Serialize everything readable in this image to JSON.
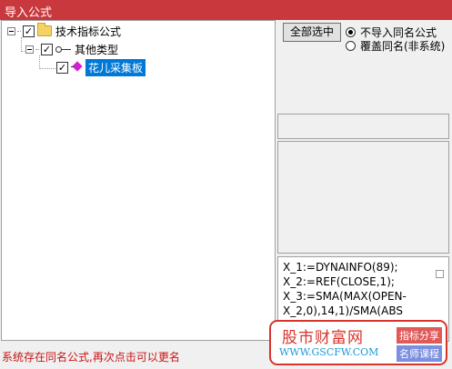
{
  "window": {
    "title": "导入公式"
  },
  "tree": {
    "root": {
      "label": "技术指标公式",
      "checked": true
    },
    "child": {
      "label": "其他类型",
      "checked": true
    },
    "leaf": {
      "label": "花儿采集板",
      "checked": true
    }
  },
  "options": {
    "select_all_label": "全部选中",
    "radio_skip_label": "不导入同名公式",
    "radio_overwrite_label": "覆盖同名(非系统)",
    "selected": "radio_skip"
  },
  "formula_code": [
    "X_1:=DYNAINFO(89);",
    "X_2:=REF(CLOSE,1);",
    "X_3:=SMA(MAX(OPEN-",
    "X_2,0),14,1)/SMA(ABS"
  ],
  "watermark": {
    "title": "股市财富网",
    "url": "WWW.GSCFW.COM",
    "tag1": "指标分享",
    "tag2": "名师课程"
  },
  "status_message": "系统存在同名公式,再次点击可以更名",
  "colors": {
    "titlebar": "#c8383c",
    "selection": "#0078d7",
    "status_text": "#c81414"
  }
}
